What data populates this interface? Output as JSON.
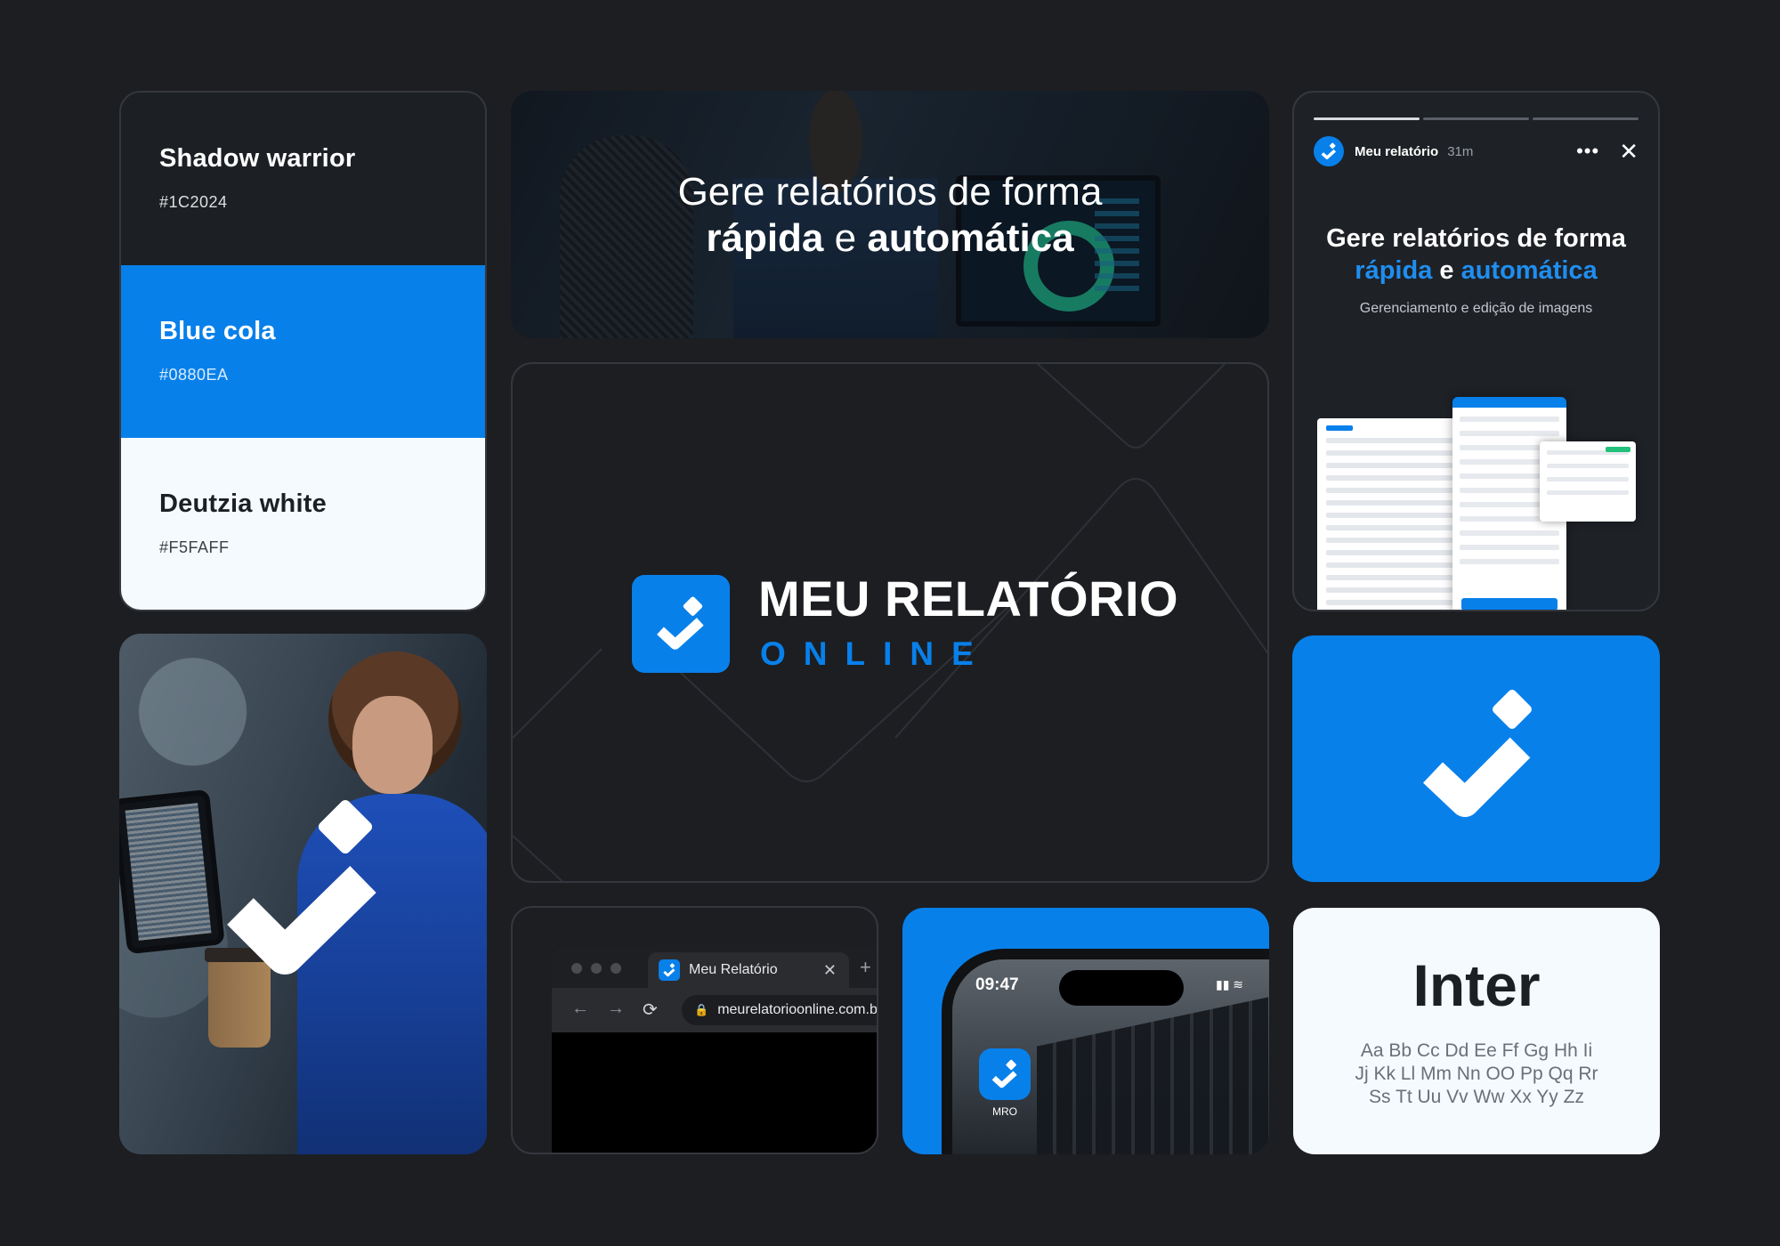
{
  "colors": {
    "background": "#1c1e22",
    "shadow_warrior": "#1C2024",
    "blue_cola": "#0880EA",
    "deutzia_white": "#F5FAFF"
  },
  "palette": {
    "swatches": [
      {
        "name": "Shadow warrior",
        "hex": "#1C2024"
      },
      {
        "name": "Blue cola",
        "hex": "#0880EA"
      },
      {
        "name": "Deutzia white",
        "hex": "#F5FAFF"
      }
    ]
  },
  "banner": {
    "line1": "Gere relatórios de forma",
    "word_a": "rápida",
    "connector": "e",
    "word_b": "automática"
  },
  "story": {
    "username": "Meu relatório",
    "time": "31m",
    "menu_icon": "more-horizontal-icon",
    "close_icon": "close-icon",
    "close_glyph": "✕",
    "dots_glyph": "•••",
    "title_line1": "Gere relatórios de forma",
    "word_a": "rápida",
    "connector": "e",
    "word_b": "automática",
    "subtitle": "Gerenciamento e edição de imagens"
  },
  "brand": {
    "name": "MEU RELATÓRIO",
    "sub": "ONLINE",
    "icon": "check-logo-icon"
  },
  "browser": {
    "tab_title": "Meu Relatório",
    "tab_close": "✕",
    "tab_new": "+",
    "back": "←",
    "forward": "→",
    "reload": "⟳",
    "lock": "🔒",
    "url": "meurelatorioonline.com.br"
  },
  "phone": {
    "time": "09:47",
    "app_label": "MRO",
    "status_glyphs": "▮▮ ≋"
  },
  "typography": {
    "font_name": "Inter",
    "lines": [
      "Aa Bb Cc Dd Ee Ff Gg Hh Ii",
      "Jj Kk Ll Mm Nn OO Pp Qq Rr",
      "Ss Tt Uu Vv Ww Xx Yy Zz"
    ]
  }
}
